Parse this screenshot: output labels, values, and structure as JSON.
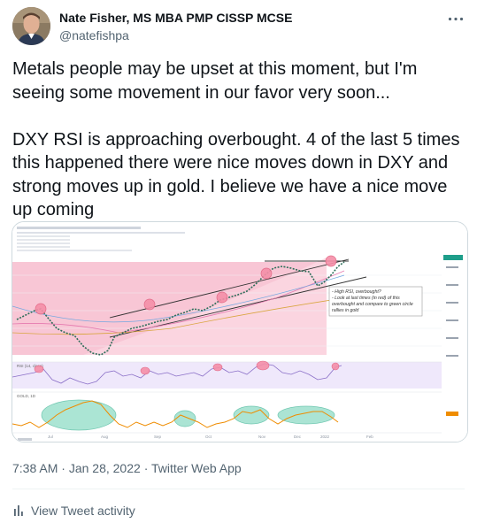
{
  "author": {
    "name": "Nate Fisher, MS MBA PMP CISSP MCSE",
    "handle": "@natefishpa"
  },
  "tweet": {
    "text": "Metals people may be upset at this moment, but I'm seeing some movement in our favor very soon...\n\nDXY RSI is approaching overbought.  4 of the last 5 times this happened there were nice moves down in DXY and strong moves up in gold.  I believe we have a nice move up coming"
  },
  "media": {
    "annotation_lines": [
      "- High RSI, overbought?",
      "- Look at last times (in red) of this",
      "overbought and compare to green circle",
      "rallies in gold"
    ],
    "x_axis_labels": [
      "Jul",
      "Aug",
      "Sep",
      "Oct",
      "Nov",
      "Dec",
      "2022",
      "Feb"
    ],
    "rsi_label": "RSI (14, close)",
    "gold_label": "GOLD, 1D",
    "icon_chart": "tradingview-chart"
  },
  "meta": {
    "time": "7:38 AM",
    "separator": "·",
    "date": "Jan 28, 2022",
    "app": "Twitter Web App"
  },
  "activity": {
    "label": "View Tweet activity",
    "icon": "bar-chart-icon"
  },
  "colors": {
    "text": "#0f1419",
    "secondary": "#536471",
    "border": "#cfd9de",
    "pink_zone": "#f7c6d4",
    "green_circle": "#7fd1b9",
    "gold_line": "#ef8c00",
    "rsi_line": "#8a6fc7"
  }
}
